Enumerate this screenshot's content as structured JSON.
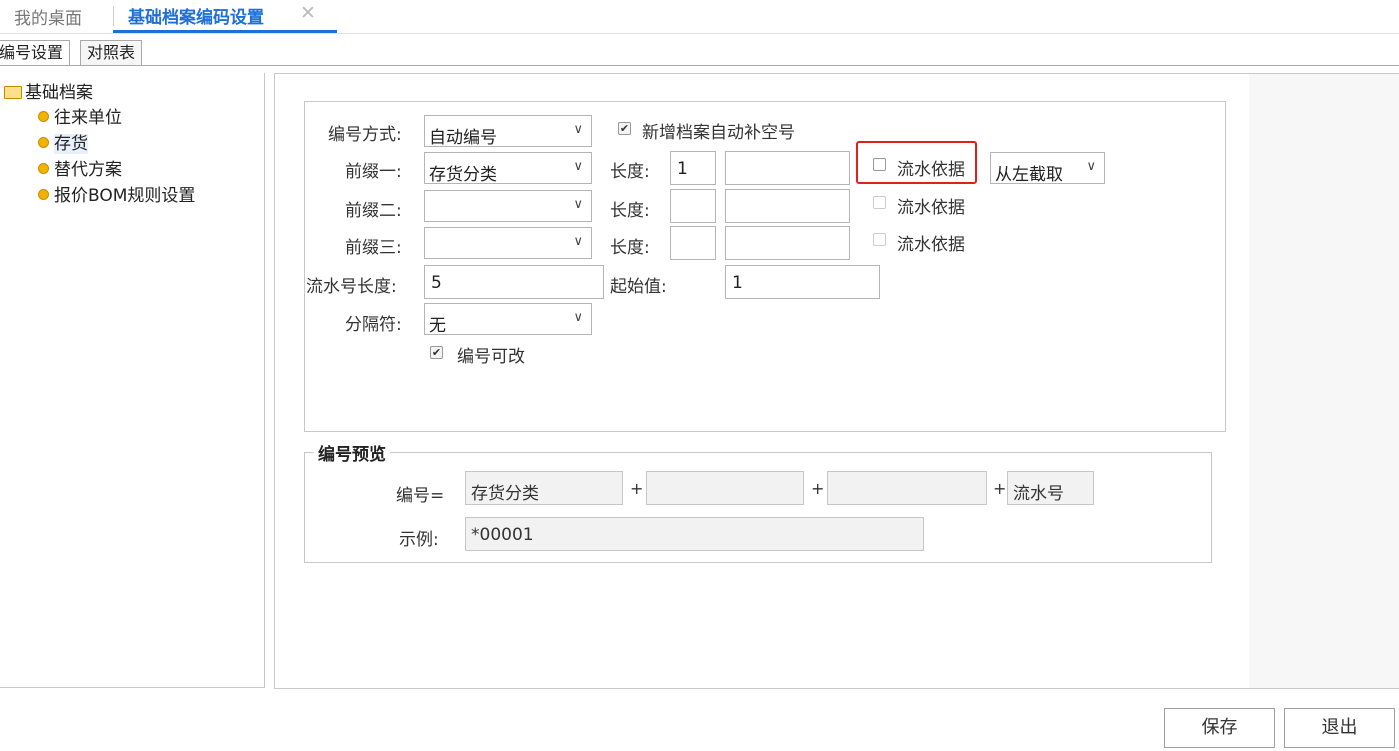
{
  "tabs": {
    "home": "我的桌面",
    "active": "基础档案编码设置",
    "close": "✕"
  },
  "subtabs": [
    "编号设置",
    "对照表"
  ],
  "tree": {
    "root": "基础档案",
    "items": [
      "往来单位",
      "存货",
      "替代方案",
      "报价BOM规则设置"
    ]
  },
  "form": {
    "mode_label": "编号方式:",
    "mode_value": "自动编号",
    "autofill_label": "新增档案自动补空号",
    "prefix1_label": "前缀一:",
    "prefix1_value": "存货分类",
    "prefix2_label": "前缀二:",
    "prefix2_value": "",
    "prefix3_label": "前缀三:",
    "prefix3_value": "",
    "length_label": "长度:",
    "length1_value": "1",
    "length2_value": "",
    "length3_value": "",
    "extra1_value": "",
    "extra2_value": "",
    "extra3_value": "",
    "serial_basis_label": "流水依据",
    "cut_value": "从左截取",
    "serial_len_label": "流水号长度:",
    "serial_len_value": "5",
    "start_label": "起始值:",
    "start_value": "1",
    "sep_label": "分隔符:",
    "sep_value": "无",
    "editable_label": "编号可改"
  },
  "preview": {
    "legend": "编号预览",
    "code_label": "编号=",
    "part1": "存货分类",
    "part2": "",
    "part3": "",
    "part4": "流水号",
    "plus": "+",
    "example_label": "示例:",
    "example_value": "*00001"
  },
  "buttons": {
    "save": "保存",
    "exit": "退出"
  },
  "colors": {
    "accent": "#1e6fd9",
    "highlight": "#e1201b",
    "node": "#f0b400"
  }
}
